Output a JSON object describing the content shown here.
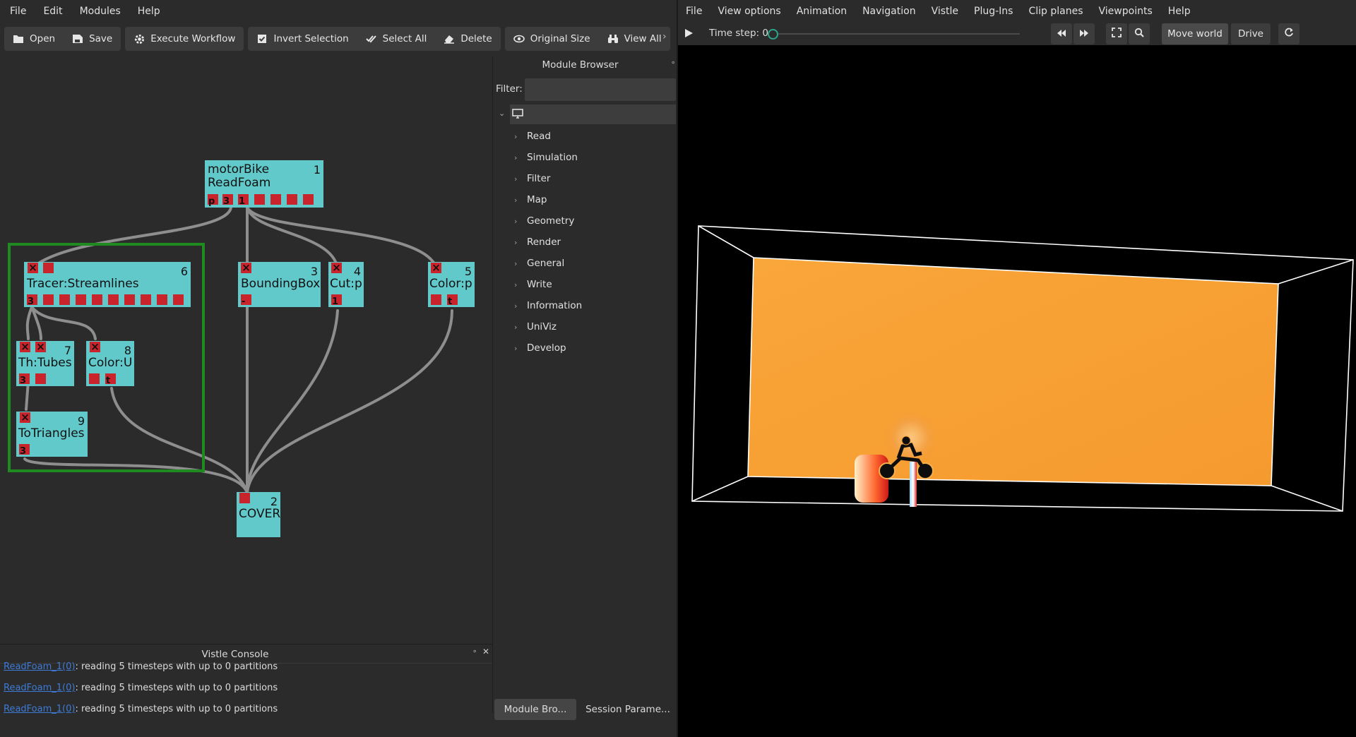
{
  "left": {
    "menu": [
      "File",
      "Edit",
      "Modules",
      "Help"
    ],
    "toolbar": {
      "open": "Open",
      "save": "Save",
      "execute": "Execute Workflow",
      "invert": "Invert Selection",
      "select_all": "Select All",
      "delete": "Delete",
      "original_size": "Original Size",
      "view_all": "View All"
    },
    "modules": {
      "readfoam": {
        "line1": "motorBike",
        "line2": "ReadFoam",
        "num": "1",
        "ports": [
          "p",
          "3",
          "1"
        ]
      },
      "cover": {
        "title": "COVER",
        "num": "2"
      },
      "bbox": {
        "title": "BoundingBox",
        "num": "3",
        "port": "-"
      },
      "cut": {
        "title": "Cut:p",
        "num": "4",
        "port": "1"
      },
      "colorp": {
        "title": "Color:p",
        "num": "5",
        "port": "t"
      },
      "tracer": {
        "title": "Tracer:Streamlines",
        "num": "6",
        "port": "3"
      },
      "tubes": {
        "title": "Th:Tubes",
        "num": "7",
        "port": "3"
      },
      "coloru": {
        "title": "Color:U",
        "num": "8",
        "port": "t"
      },
      "totri": {
        "title": "ToTriangles",
        "num": "9",
        "port": "3"
      }
    },
    "module_browser": {
      "title": "Module Browser",
      "filter_label": "Filter:",
      "filter_value": "",
      "categories": [
        "Read",
        "Simulation",
        "Filter",
        "Map",
        "Geometry",
        "Render",
        "General",
        "Write",
        "Information",
        "UniViz",
        "Develop"
      ],
      "tab_module": "Module Bro...",
      "tab_session": "Session Parame..."
    },
    "console": {
      "title": "Vistle Console",
      "lines": [
        {
          "link": "ReadFoam_1(0)",
          "text": ": reading 5 timesteps with up to 0 partitions"
        },
        {
          "link": "ReadFoam_1(0)",
          "text": ": reading 5 timesteps with up to 0 partitions"
        },
        {
          "link": "ReadFoam_1(0)",
          "text": ": reading 5 timesteps with up to 0 partitions"
        }
      ]
    }
  },
  "right": {
    "menu": [
      "File",
      "View options",
      "Animation",
      "Navigation",
      "Vistle",
      "Plug-Ins",
      "Clip planes",
      "Viewpoints",
      "Help"
    ],
    "timestep_label": "Time step: 0",
    "move_world": "Move world",
    "drive": "Drive"
  },
  "colors": {
    "module_fill": "#62c9cb",
    "port": "#c9232b",
    "selection": "#1f8a1f",
    "plane": "#f7a133",
    "background": "#2b2b2b"
  }
}
